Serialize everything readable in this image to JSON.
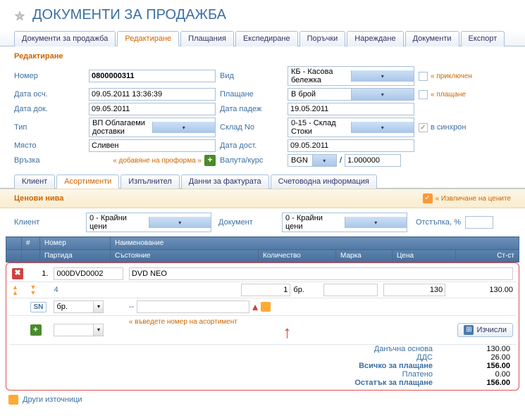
{
  "title": "ДОКУМЕНТИ ЗА ПРОДАЖБА",
  "main_tabs": [
    "Документи за продажба",
    "Редактиране",
    "Плащания",
    "Експедиране",
    "Поръчки",
    "Нареждане",
    "Документи",
    "Експорт"
  ],
  "active_main_tab": 1,
  "section_title": "Редактиране",
  "form": {
    "labels": {
      "number": "Номер",
      "date_acc": "Дата осч.",
      "date_doc": "Дата док.",
      "type": "Тип",
      "place": "Място",
      "link": "Връзка",
      "kind": "Вид",
      "payment": "Плащане",
      "date_due": "Дата падеж",
      "warehouse": "Склад No",
      "date_deliv": "Дата дост.",
      "currency": "Валута/курс"
    },
    "values": {
      "number": "0800000311",
      "date_acc": "09.05.2011 13:36:39",
      "date_doc": "09.05.2011",
      "type": "ВП Облагаеми доставки",
      "place": "Сливен",
      "kind": "КБ - Касова бележка",
      "payment": "В брой",
      "date_due": "19.05.2011",
      "warehouse": "0-15 - Склад Стоки",
      "date_deliv": "09.05.2011",
      "currency_code": "BGN",
      "currency_rate": "1.000000"
    },
    "links": {
      "proforma": "добавяне на проформа »",
      "closed": "приключен",
      "payment_new": "плащане",
      "in_sync": "в синхрон"
    }
  },
  "subtabs": [
    "Клиент",
    "Асортименти",
    "Изпълнител",
    "Данни за фактурата",
    "Счетоводна информация"
  ],
  "active_subtab": 1,
  "price_levels": {
    "title": "Ценови нива",
    "extract_prices": "Извличане на цените",
    "client_label": "Клиент",
    "client_value": "0 - Крайни цени",
    "document_label": "Документ",
    "document_value": "0 - Крайни цени",
    "discount_label": "Отстъпка, %",
    "discount_value": ""
  },
  "grid": {
    "headers": {
      "num": "#",
      "code": "Номер",
      "name": "Наименование",
      "batch": "Партида",
      "state": "Състояние",
      "qty": "Количество",
      "brand": "Марка",
      "price": "Цена",
      "amount": "Ст-ст"
    },
    "row": {
      "index": "1.",
      "code": "000DVD0002",
      "name": "DVD NEO",
      "batch": "4",
      "qty": "1",
      "unit": "бр.",
      "price": "130",
      "amount": "130.00",
      "br_unit": "бр.",
      "state_dash": "--"
    },
    "new_hint": "въведете номер на асортимент",
    "sn": "SN",
    "calc_button": "Изчисли"
  },
  "totals": {
    "labels": {
      "base": "Данъчна основа",
      "vat": "ДДС",
      "total": "Всичко за плащане",
      "paid": "Платено",
      "due": "Остатък за плащане"
    },
    "values": {
      "base": "130.00",
      "vat": "26.00",
      "total": "156.00",
      "paid": "0.00",
      "due": "156.00"
    }
  },
  "footer_link": "Други източници"
}
